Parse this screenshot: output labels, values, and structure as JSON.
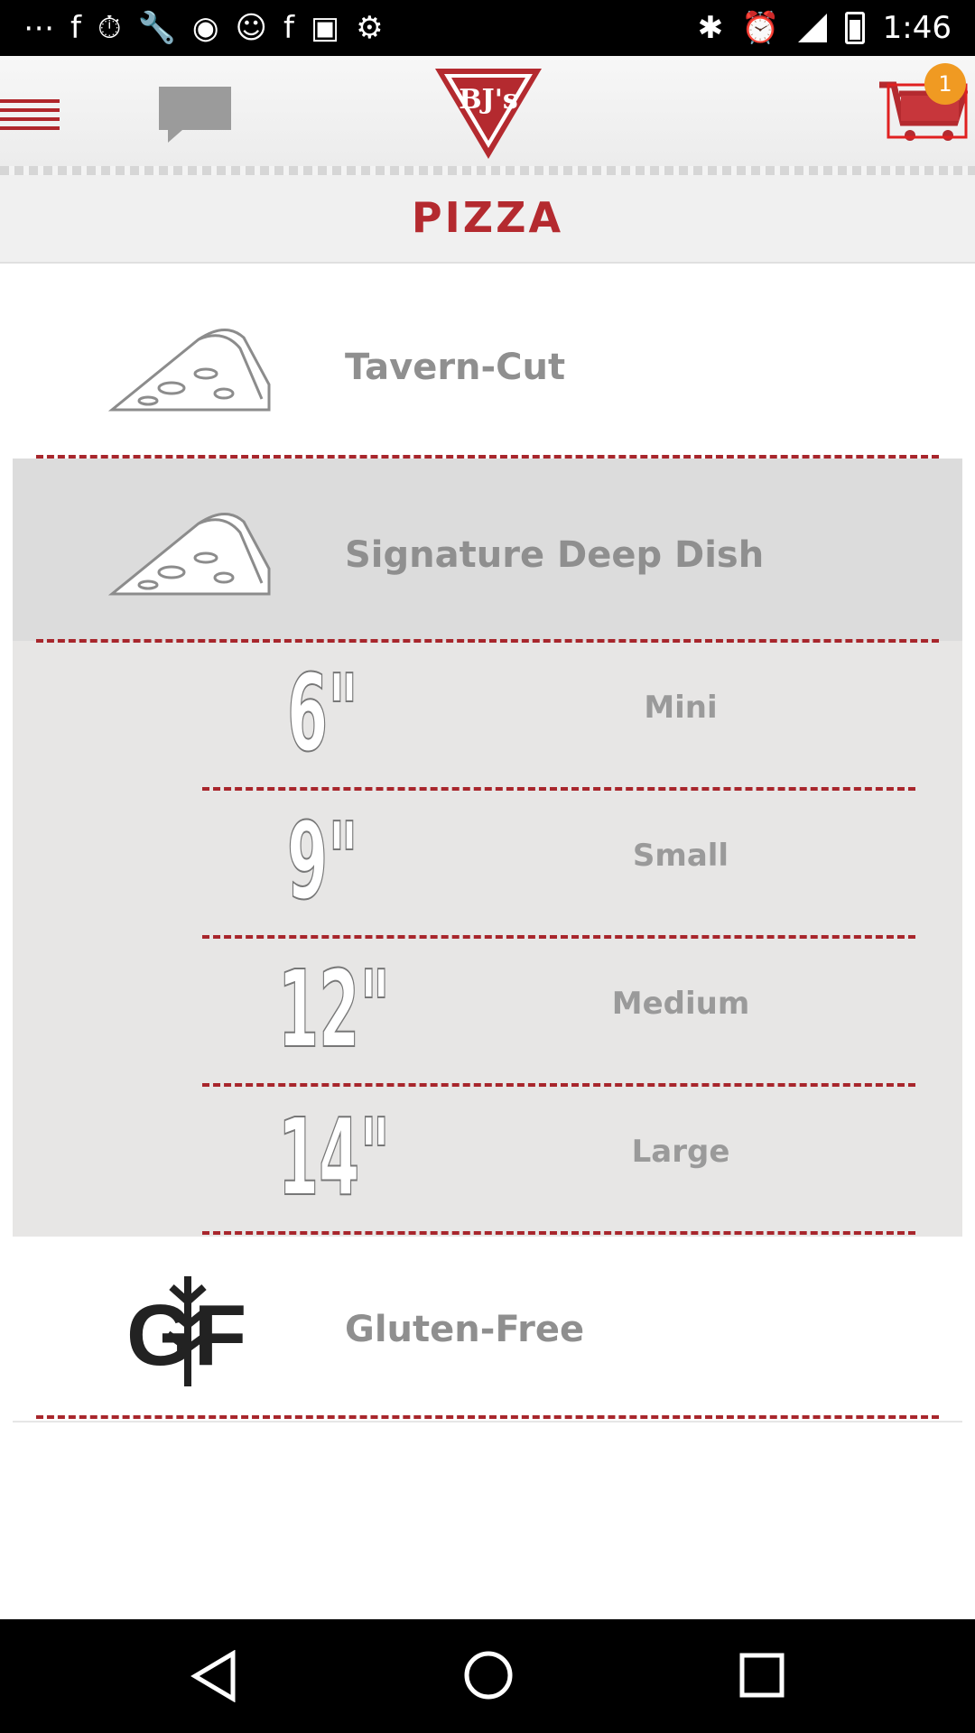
{
  "status_bar": {
    "time": "1:46"
  },
  "header": {
    "logo_text": "BJ's",
    "cart_count": "1"
  },
  "page": {
    "title": "PIZZA"
  },
  "categories": [
    {
      "label": "Tavern-Cut",
      "icon": "pizza-slice-icon"
    },
    {
      "label": "Signature Deep Dish",
      "icon": "pizza-slice-icon"
    },
    {
      "label": "Gluten-Free",
      "icon": "gluten-free-icon",
      "icon_text": "GF"
    }
  ],
  "sizes": [
    {
      "number": "6\"",
      "label": "Mini"
    },
    {
      "number": "9\"",
      "label": "Small"
    },
    {
      "number": "12\"",
      "label": "Medium"
    },
    {
      "number": "14\"",
      "label": "Large"
    }
  ],
  "colors": {
    "brand_red": "#b42a2f",
    "badge_orange": "#f09a22"
  }
}
